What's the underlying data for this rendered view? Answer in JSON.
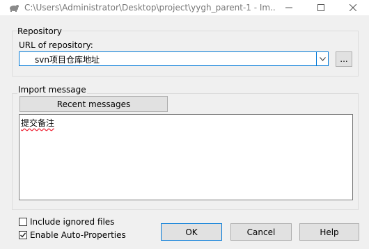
{
  "window": {
    "title": "C:\\Users\\Administrator\\Desktop\\project\\yygh_parent-1 - Im..."
  },
  "repository": {
    "group_label": "Repository",
    "url_label": "URL of repository:",
    "url_value": "svn项目仓库地址",
    "browse_label": "..."
  },
  "import_message": {
    "group_label": "Import message",
    "recent_button": "Recent messages",
    "message_text": "提交备注"
  },
  "options": {
    "include_ignored": {
      "label": "Include ignored files",
      "checked": false
    },
    "auto_properties": {
      "label": "Enable Auto-Properties",
      "checked": true
    }
  },
  "buttons": {
    "ok": "OK",
    "cancel": "Cancel",
    "help": "Help"
  }
}
